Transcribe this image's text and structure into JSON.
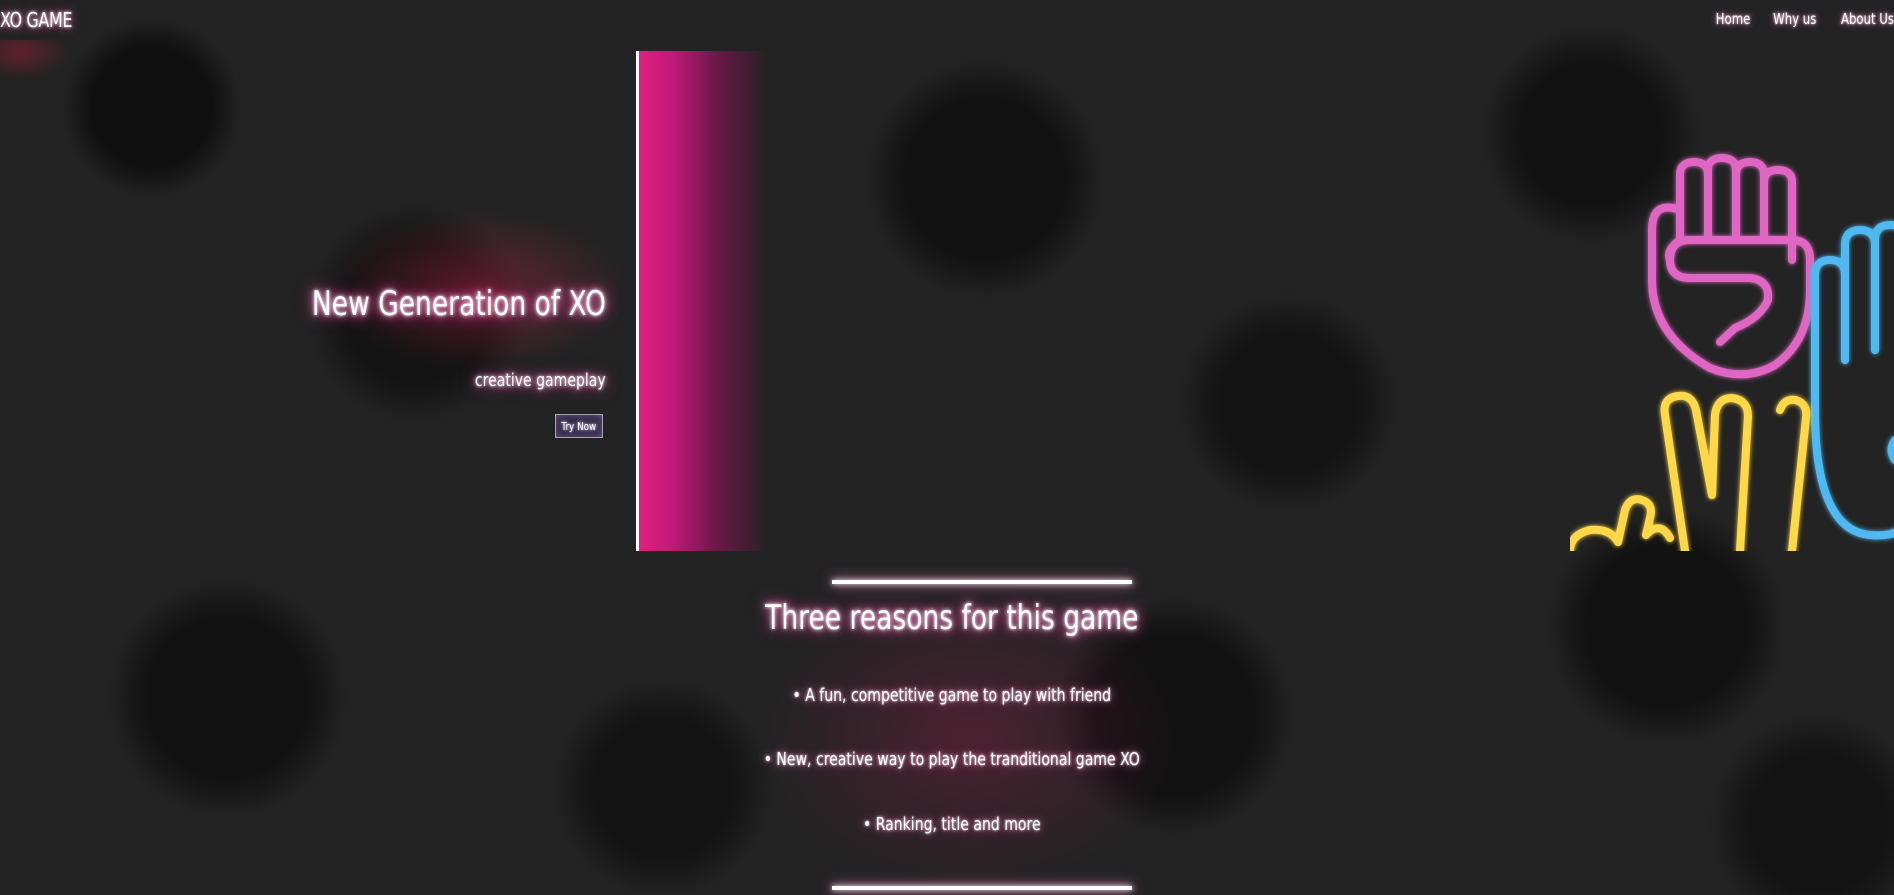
{
  "header": {
    "brand": "XO GAME",
    "nav": [
      "Home",
      "Why us",
      "About Us"
    ]
  },
  "hero": {
    "title": "New Generation of XO",
    "subtitle": "creative gameplay",
    "cta_label": "Try Now",
    "image_icon": "neon-rock-paper-scissors-hands"
  },
  "reasons": {
    "title": "Three reasons for this game",
    "items": [
      "• A fun, competitive game to play with friend",
      "• New, creative way to play the tranditional game XO",
      "• Ranking, title and more"
    ]
  },
  "colors": {
    "background": "#232323",
    "accent_pink": "#e0207f",
    "neon_pink": "#e066c4",
    "neon_yellow": "#ffd84a",
    "neon_blue": "#4fb8f0",
    "text": "#ffffff"
  }
}
